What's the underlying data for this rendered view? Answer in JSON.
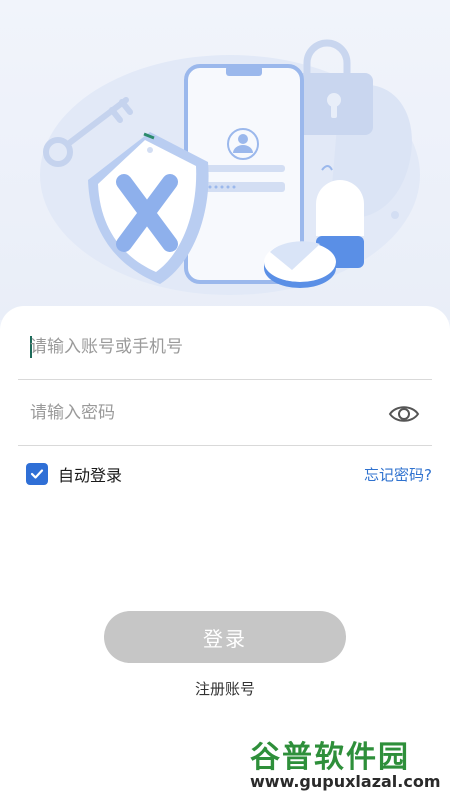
{
  "login_form": {
    "account_placeholder": "请输入账号或手机号",
    "password_placeholder": "请输入密码",
    "remember_label": "自动登录",
    "remember_checked": true,
    "forgot_label": "忘记密码?",
    "login_label": "登录",
    "register_label": "注册账号"
  },
  "watermark": {
    "title": "谷普软件园",
    "url": "www.gupuxlazal.com"
  },
  "colors": {
    "accent": "#2f6fd6",
    "link": "#2f72cf",
    "button_disabled": "#c6c6c6",
    "illustration": "#9bb8ec"
  },
  "icons": [
    "key-icon",
    "lock-icon",
    "shield-icon",
    "phone-icon",
    "user-avatar-icon",
    "pill-icon",
    "eye-icon",
    "check-icon"
  ]
}
